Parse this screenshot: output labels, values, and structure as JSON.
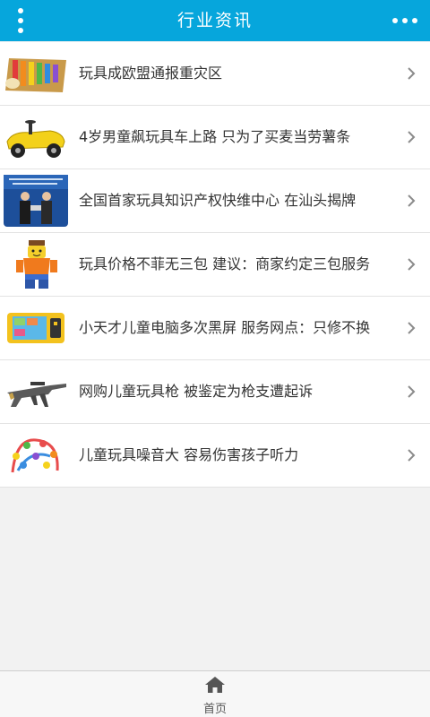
{
  "header": {
    "title": "行业资讯",
    "menu_icon": "vertical-dots-menu-icon",
    "more_icon": "horizontal-dots-more-icon",
    "bg_color": "#06a6dc"
  },
  "news": [
    {
      "title": "玩具成欧盟通报重灾区",
      "thumb": "xylophone-toy"
    },
    {
      "title": "4岁男童飙玩具车上路 只为了买麦当劳薯条",
      "thumb": "yellow-toy-car"
    },
    {
      "title": "全国首家玩具知识产权快维中心 在汕头揭牌",
      "thumb": "ceremony-photo"
    },
    {
      "title": "玩具价格不菲无三包 建议：商家约定三包服务",
      "thumb": "lego-figure"
    },
    {
      "title": "小天才儿童电脑多次黑屏 服务网点：只修不换",
      "thumb": "kids-tablet"
    },
    {
      "title": "网购儿童玩具枪 被鉴定为枪支遭起诉",
      "thumb": "toy-rifle"
    },
    {
      "title": "儿童玩具噪音大 容易伤害孩子听力",
      "thumb": "bead-maze-toy"
    }
  ],
  "footer": {
    "home_label": "首页",
    "home_icon": "home-icon"
  }
}
